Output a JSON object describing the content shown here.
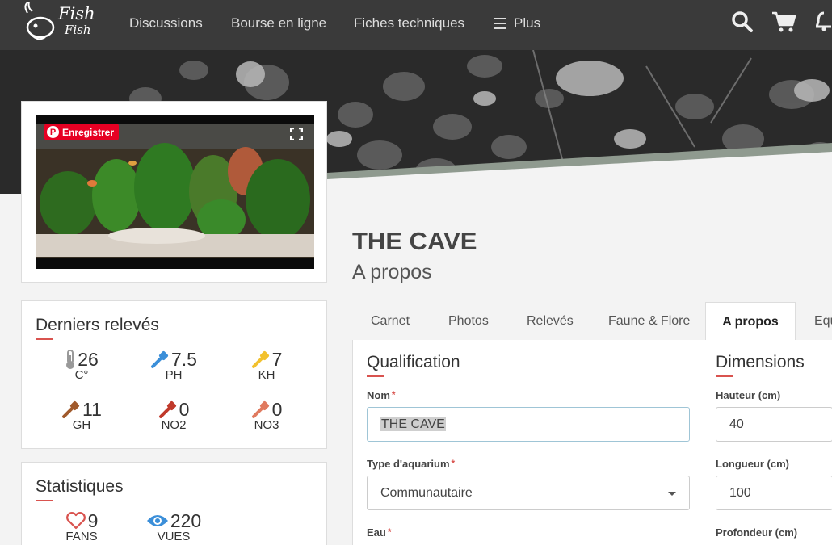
{
  "nav": {
    "logo_line1": "Fish",
    "logo_line2": "Fish",
    "links": [
      "Discussions",
      "Bourse en ligne",
      "Fiches techniques"
    ],
    "more_label": "Plus"
  },
  "photo": {
    "pin_label": "Enregistrer"
  },
  "readings": {
    "title": "Derniers relevés",
    "items": [
      {
        "value": "26",
        "label": "C°",
        "icon": "thermometer-icon",
        "color": "#999999"
      },
      {
        "value": "7.5",
        "label": "PH",
        "icon": "dropper-icon",
        "color": "#3b8fd9"
      },
      {
        "value": "7",
        "label": "KH",
        "icon": "dropper-icon",
        "color": "#f2c12e"
      },
      {
        "value": "11",
        "label": "GH",
        "icon": "dropper-icon",
        "color": "#a05a2c"
      },
      {
        "value": "0",
        "label": "NO2",
        "icon": "dropper-icon",
        "color": "#c0392b"
      },
      {
        "value": "0",
        "label": "NO3",
        "icon": "dropper-icon",
        "color": "#e07a5f"
      }
    ]
  },
  "stats": {
    "title": "Statistiques",
    "fans_value": "9",
    "fans_label": "FANS",
    "views_value": "220",
    "views_label": "VUES"
  },
  "page": {
    "title": "THE CAVE",
    "subtitle": "A propos"
  },
  "tabs": [
    "Carnet",
    "Photos",
    "Relevés",
    "Faune & Flore",
    "A propos",
    "Equ"
  ],
  "active_tab": "A propos",
  "form": {
    "qualification_title": "Qualification",
    "dimensions_title": "Dimensions",
    "nom_label": "Nom",
    "nom_value": "THE CAVE",
    "type_label": "Type d'aquarium",
    "type_value": "Communautaire",
    "eau_label": "Eau",
    "hauteur_label": "Hauteur (cm)",
    "hauteur_value": "40",
    "longueur_label": "Longueur (cm)",
    "longueur_value": "100",
    "profondeur_label": "Profondeur (cm)"
  }
}
